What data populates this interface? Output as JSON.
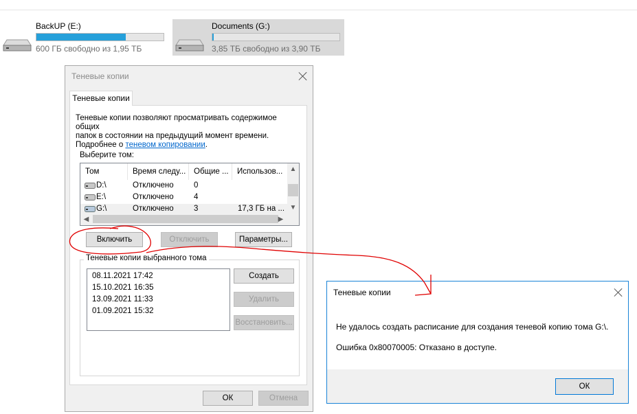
{
  "drives": [
    {
      "name": "BackUP (E:)",
      "free": "600 ГБ свободно из 1,95 ТБ",
      "used_fraction": 0.7,
      "selected": false
    },
    {
      "name": "Documents (G:)",
      "free": "3,85 ТБ свободно из 3,90 ТБ",
      "used_fraction": 0.01,
      "selected": true
    }
  ],
  "shadow_dialog": {
    "title": "Теневые копии",
    "tab": "Теневые копии",
    "description_line1": "Теневые копии позволяют просматривать содержимое общих",
    "description_line2": "папок в состоянии на предыдущий момент времени.",
    "description_prefix": "Подробнее о ",
    "description_link": "теневом копировании",
    "description_suffix": ".",
    "select_volume_label": "Выберите том:",
    "columns": [
      "Том",
      "Время следу...",
      "Общие ...",
      "Использов..."
    ],
    "volumes": [
      {
        "vol": "D:\\",
        "next": "Отключено",
        "shares": "0",
        "used": ""
      },
      {
        "vol": "E:\\",
        "next": "Отключено",
        "shares": "4",
        "used": ""
      },
      {
        "vol": "G:\\",
        "next": "Отключено",
        "shares": "3",
        "used": "17,3 ГБ на ..."
      }
    ],
    "enable_button": "Включить",
    "disable_button": "Отключить",
    "settings_button": "Параметры...",
    "group_label": "Теневые копии выбранного тома",
    "snapshots": [
      "08.11.2021 17:42",
      "15.10.2021 16:35",
      "13.09.2021 11:33",
      "01.09.2021 15:32"
    ],
    "create_button": "Создать",
    "delete_button": "Удалить",
    "restore_button": "Восстановить...",
    "ok_button": "ОК",
    "cancel_button": "Отмена"
  },
  "error_dialog": {
    "title": "Теневые копии",
    "message": "Не удалось создать расписание для создания теневой копию тома G:\\.",
    "error": "Ошибка 0x80070005: Отказано в доступе.",
    "ok_button": "ОК"
  },
  "colors": {
    "accent": "#0078d7",
    "bar_fill": "#26a0da",
    "annotation": "#e00000"
  }
}
